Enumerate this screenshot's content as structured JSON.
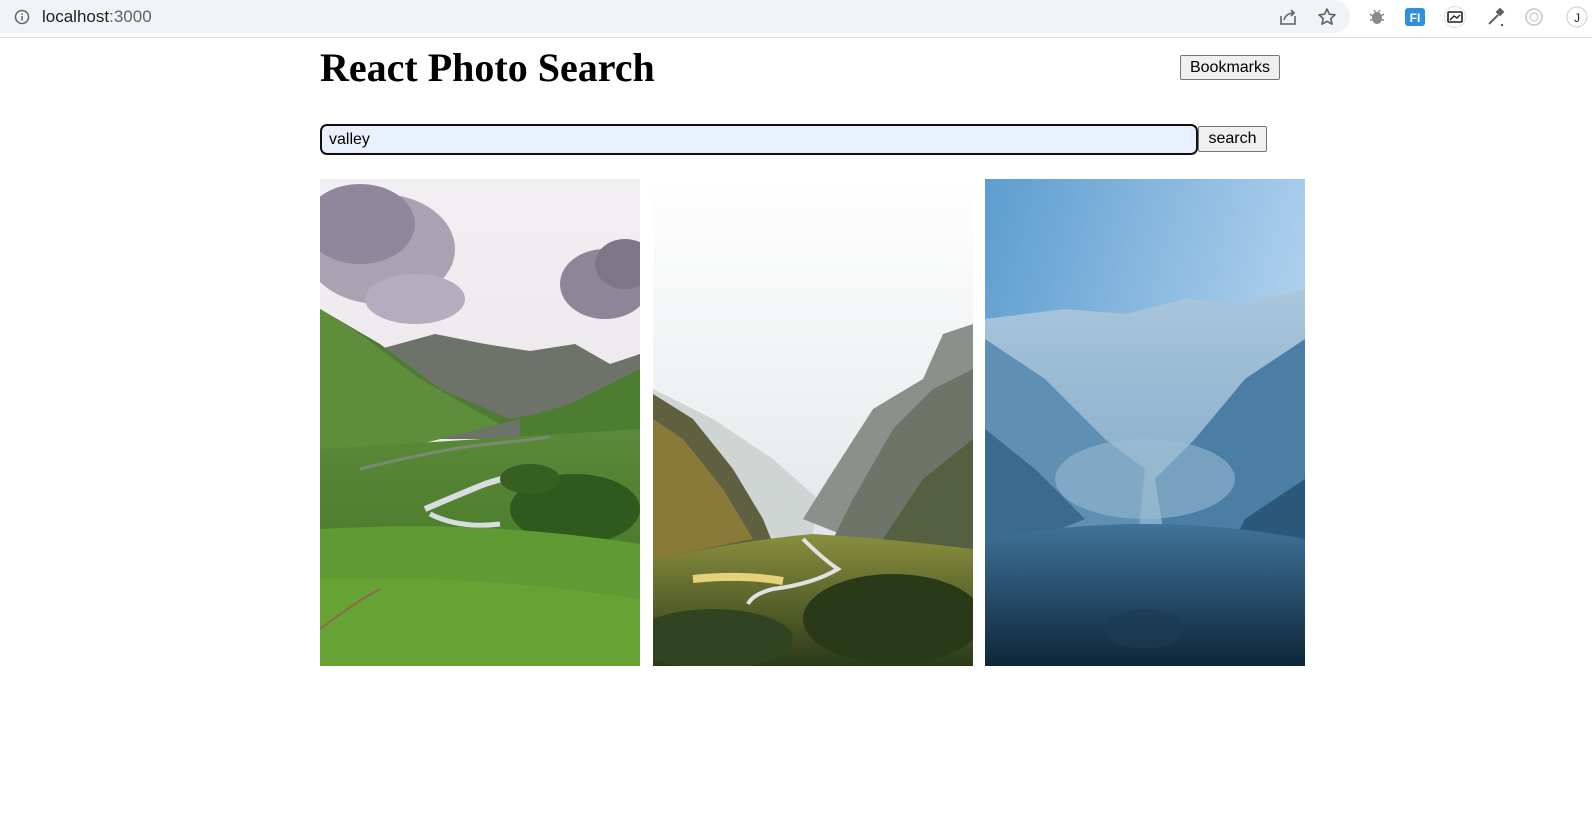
{
  "browser": {
    "url_host": "localhost",
    "url_port": ":3000",
    "toolbar_icons": [
      "share-icon",
      "star-icon",
      "bug-extension-icon",
      "fi-extension-icon",
      "screen-extension-icon",
      "eyedropper-extension-icon",
      "circle-extension-icon",
      "profile-icon"
    ]
  },
  "header": {
    "title": "React Photo Search",
    "bookmarks_label": "Bookmarks"
  },
  "search": {
    "value": "valley",
    "button_label": "search"
  },
  "photos": [
    {
      "subject": "green valley with river and clouds"
    },
    {
      "subject": "rocky canyon valley with winding river"
    },
    {
      "subject": "misty blue valley"
    }
  ],
  "colors": {
    "input_bg": "#e8f0fe",
    "button_bg": "#efefef"
  }
}
